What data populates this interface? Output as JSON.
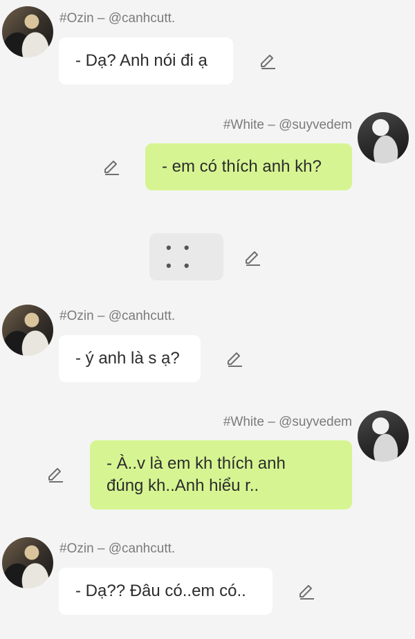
{
  "messages": [
    {
      "author": "#Ozin – @canhcutt.",
      "text": "- Dạ? Anh nói đi ạ"
    },
    {
      "author": "#White – @suyvedem",
      "text": "- em có thích anh kh?"
    },
    {
      "text": "• • • •"
    },
    {
      "author": "#Ozin – @canhcutt.",
      "text": "- ý anh là s ạ?"
    },
    {
      "author": "#White – @suyvedem",
      "line1": "- À..v là em kh thích anh",
      "line2": "đúng kh..Anh hiểu r.."
    },
    {
      "author": "#Ozin – @canhcutt.",
      "text": "- Dạ?? Đâu có..em có.."
    }
  ],
  "icons": {
    "avatar": "profile-photo",
    "edit": "pencil-edit-icon"
  },
  "colors": {
    "background": "#f4f4f4",
    "incoming_bubble": "#ffffff",
    "outgoing_bubble": "#d6f592",
    "typing_bubble": "#e9e9e9",
    "author_text": "#7a7a7a"
  }
}
